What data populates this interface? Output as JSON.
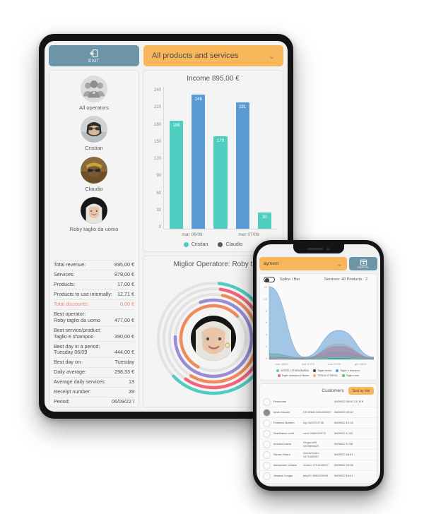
{
  "tablet": {
    "topbar": {
      "exit_label": "EXIT",
      "exit_icon": "exit-door-icon",
      "dropdown_value": "All products and services",
      "dropdown_icon": "chevron-down-icon"
    },
    "sidebar": {
      "operators": [
        {
          "name": "All operators",
          "avatar": "group-people-icon"
        },
        {
          "name": "Cristian",
          "avatar": "photo-avatar"
        },
        {
          "name": "Claudio",
          "avatar": "photo-avatar"
        },
        {
          "name": "Roby taglio da uomo",
          "avatar": "photo-avatar"
        }
      ]
    },
    "stats": [
      {
        "key": "Total revenue:",
        "value": "895,00 €"
      },
      {
        "key": "Services:",
        "value": "878,00 €"
      },
      {
        "key": "Products:",
        "value": "17,00 €"
      },
      {
        "key": "Products to use internally:",
        "value": "12,71 €"
      },
      {
        "key": "Total discounts:",
        "value": "0,00 €",
        "highlight": "#f08a7a"
      },
      {
        "key": "Best operator:",
        "sub": "Roby taglio da uomo",
        "value": "477,00 €"
      },
      {
        "key": "Best service/product:",
        "sub": "Taglio e shampoo",
        "value": "390,00 €"
      },
      {
        "key": "Best day in a period:",
        "sub": "Tuesday 06/09",
        "value": "444,00 €"
      },
      {
        "key": "Best day on:",
        "value": "Tuesday"
      },
      {
        "key": "Daily average:",
        "value": "298,33 €"
      },
      {
        "key": "Average daily services:",
        "value": "13"
      },
      {
        "key": "Receipt number:",
        "value": "39"
      },
      {
        "key": "Period:",
        "value": "06/09/22 /"
      }
    ],
    "income_chart_title": "Income 895,00 €",
    "operator_panel_title": "Miglior Operatore: Roby t"
  },
  "phone": {
    "topbar": {
      "dropdown_value": "ayment",
      "period_label": "PERIOD",
      "period_icon": "calendar-icon",
      "dropdown_icon": "chevron-down-icon"
    },
    "chart_head": {
      "toggle_label": "Spline / Bar",
      "stats": "Services: 40  Products : 2"
    },
    "customers": {
      "title": "Customers",
      "sort_label": "Sort by dat",
      "rows": [
        {
          "name": "Personale",
          "alias": "",
          "date": "06/09/22 08:50",
          "amount": "13,00 €",
          "avatar": "empty-avatar"
        },
        {
          "name": "kevin trisconi",
          "alias": "KEVIN08 3450400567",
          "date": "06/09/22 09:42",
          "avatar": "photo-avatar"
        },
        {
          "name": "Federico Barberi",
          "alias": "trip 3493712738",
          "date": "06/09/22 10:15",
          "avatar": "empty-avatar"
        },
        {
          "name": "Gianfranco conti",
          "alias": "conti 3386032975",
          "date": "06/09/22 11:02",
          "avatar": "empty-avatar"
        },
        {
          "name": "monica rosina",
          "alias": "Kingone69 3478556629",
          "date": "06/09/22 11:56",
          "avatar": "empty-avatar"
        },
        {
          "name": "Nicola Solaro",
          "alias": "NicolaSolaro 3472488087",
          "date": "06/09/22 15:41",
          "avatar": "empty-avatar"
        },
        {
          "name": "alessandro viviano",
          "alias": "viviano 3791218497",
          "date": "06/09/22 16:08",
          "avatar": "empty-avatar"
        },
        {
          "name": "Jessica Congiu",
          "alias": "jeky90 3888205058",
          "date": "06/09/22 16:41",
          "avatar": "empty-avatar"
        }
      ]
    }
  },
  "chart_data": [
    {
      "type": "bar",
      "title": "Income 895,00 €",
      "categories": [
        "mar 06/09",
        "mer 07/09"
      ],
      "tick_labels": [
        "mar 06/09",
        "mer 07/09"
      ],
      "bars": [
        {
          "value": 198,
          "series": "Cristian",
          "color": "#4ecdc0"
        },
        {
          "value": 246,
          "series": "Claudio",
          "color": "#5b9bd5"
        },
        {
          "value": 170,
          "series": "Cristian",
          "color": "#4ecdc0"
        },
        {
          "value": 231,
          "series": "Claudio",
          "color": "#5b9bd5"
        },
        {
          "value": 30,
          "series": "Cristian",
          "color": "#4ecdc0"
        }
      ],
      "yticks": [
        240,
        210,
        180,
        150,
        120,
        90,
        60,
        30,
        0
      ],
      "ylim": [
        0,
        260
      ],
      "ylabel": "",
      "xlabel": "",
      "grid": false,
      "legend_position": "bottom",
      "legend": [
        {
          "label": "Cristian",
          "color": "#4ecdc0"
        },
        {
          "label": "Claudio",
          "color": "#5a5a5a"
        }
      ]
    },
    {
      "type": "area",
      "title": "",
      "x": [
        "mar 06/09",
        "mar 07/09",
        "mar 07/09",
        "gio 08/09"
      ],
      "yticks": [
        12,
        10,
        8,
        6,
        4,
        2,
        0
      ],
      "ylim": [
        0,
        13
      ],
      "grid": false,
      "legend_position": "bottom",
      "series": [
        {
          "name": "MODELLATURA BARBA",
          "color": "#4ecdc0",
          "values": [
            0,
            0,
            0.3,
            0
          ]
        },
        {
          "name": "Taglio bimbo",
          "color": "#444444",
          "values": [
            0,
            0,
            0.2,
            0
          ]
        },
        {
          "name": "Taglio e shampoo",
          "color": "#5b9bd5",
          "values": [
            12.5,
            0.4,
            5.0,
            0.4
          ]
        },
        {
          "name": "Taglio shampoo e Barba",
          "color": "#f2637e",
          "values": [
            0.4,
            0.2,
            2.2,
            0.2
          ]
        },
        {
          "name": "TAGLIO E PIEGA",
          "color": "#f3b763",
          "values": [
            0.2,
            0.2,
            2.6,
            0.2
          ]
        },
        {
          "name": "Taglio rasor",
          "color": "#5cc25c",
          "values": [
            1.0,
            0.3,
            1.3,
            0.3
          ]
        }
      ]
    },
    {
      "type": "pie",
      "title": "Miglior Operatore: Roby t",
      "rings": [
        {
          "color": "#4ecdc0",
          "fraction": 0.62
        },
        {
          "color": "#f2637e",
          "fraction": 0.56
        },
        {
          "color": "#f08a5d",
          "fraction": 0.52
        },
        {
          "color": "#9b8ad4",
          "fraction": 0.78
        },
        {
          "color": "#d8d8d8",
          "fraction": 1.0
        }
      ]
    }
  ]
}
